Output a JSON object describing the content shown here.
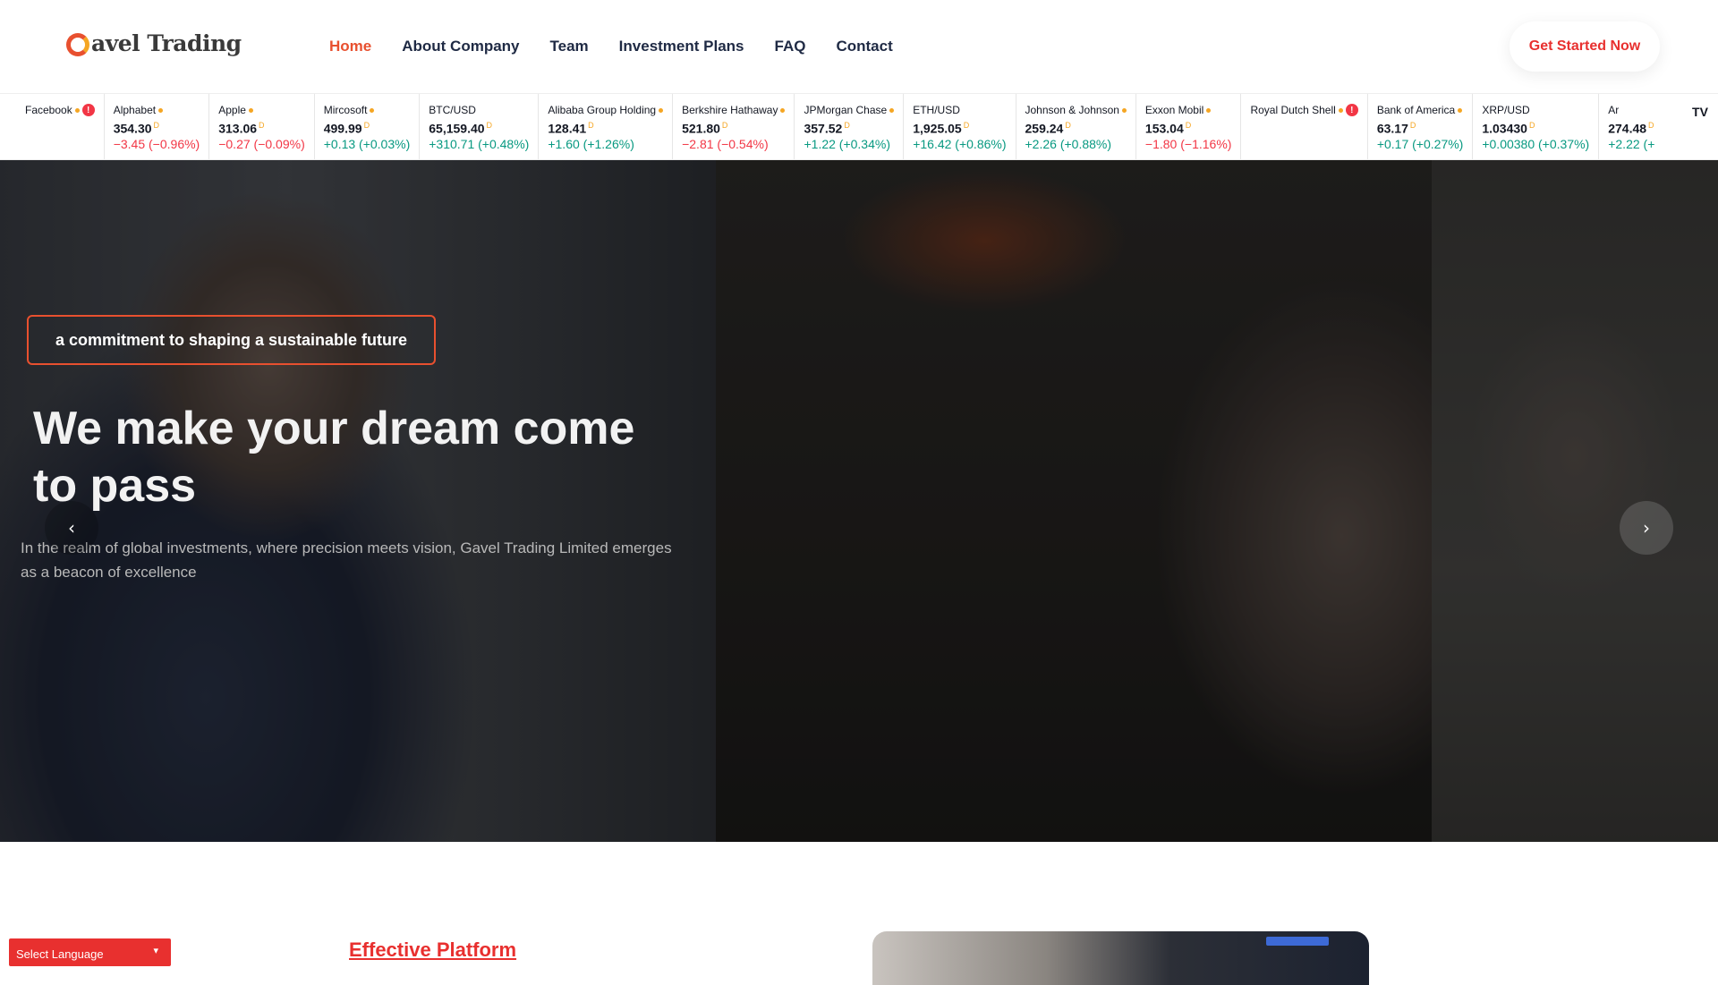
{
  "header": {
    "logo_text": "avel Trading",
    "nav": [
      "Home",
      "About Company",
      "Team",
      "Investment Plans",
      "FAQ",
      "Contact"
    ],
    "cta_label": "Get Started Now"
  },
  "ticker": [
    {
      "name": "Facebook",
      "flag": "warn",
      "price": "",
      "change": "",
      "dir": ""
    },
    {
      "name": "Alphabet",
      "flag": "dot",
      "price": "354.30",
      "change": "−3.45 (−0.96%)",
      "dir": "down"
    },
    {
      "name": "Apple",
      "flag": "dot",
      "price": "313.06",
      "change": "−0.27 (−0.09%)",
      "dir": "down"
    },
    {
      "name": "Mircosoft",
      "flag": "dot",
      "price": "499.99",
      "change": "+0.13 (+0.03%)",
      "dir": "up"
    },
    {
      "name": "BTC/USD",
      "flag": "",
      "price": "65,159.40",
      "change": "+310.71 (+0.48%)",
      "dir": "up"
    },
    {
      "name": "Alibaba Group Holding",
      "flag": "dot",
      "price": "128.41",
      "change": "+1.60 (+1.26%)",
      "dir": "up"
    },
    {
      "name": "Berkshire Hathaway",
      "flag": "dot",
      "price": "521.80",
      "change": "−2.81 (−0.54%)",
      "dir": "down"
    },
    {
      "name": "JPMorgan Chase",
      "flag": "dot",
      "price": "357.52",
      "change": "+1.22 (+0.34%)",
      "dir": "up"
    },
    {
      "name": "ETH/USD",
      "flag": "",
      "price": "1,925.05",
      "change": "+16.42 (+0.86%)",
      "dir": "up"
    },
    {
      "name": "Johnson & Johnson",
      "flag": "dot",
      "price": "259.24",
      "change": "+2.26 (+0.88%)",
      "dir": "up"
    },
    {
      "name": "Exxon Mobil",
      "flag": "dot",
      "price": "153.04",
      "change": "−1.80 (−1.16%)",
      "dir": "down"
    },
    {
      "name": "Royal Dutch Shell",
      "flag": "warn",
      "price": "",
      "change": "",
      "dir": ""
    },
    {
      "name": "Bank of America",
      "flag": "dot",
      "price": "63.17",
      "change": "+0.17 (+0.27%)",
      "dir": "up"
    },
    {
      "name": "XRP/USD",
      "flag": "",
      "price": "1.03430",
      "change": "+0.00380 (+0.37%)",
      "dir": "up"
    },
    {
      "name": "Ar",
      "flag": "",
      "price": "274.48",
      "change": "+2.22 (+",
      "dir": "up"
    }
  ],
  "ticker_badge": "D",
  "ticker_brand": "TV",
  "hero": {
    "tagline": "a commitment to shaping a sustainable future",
    "headline": "We make your dream come to pass",
    "subtext": "In the realm of global investments, where precision meets vision, Gavel Trading Limited emerges as a beacon of excellence",
    "prev_icon": "chevron-left-icon",
    "next_icon": "chevron-right-icon"
  },
  "section": {
    "heading": "Effective Platform"
  },
  "language": {
    "label": "Select Language"
  },
  "colors": {
    "accent": "#e8502f",
    "up": "#089981",
    "down": "#f23645"
  }
}
